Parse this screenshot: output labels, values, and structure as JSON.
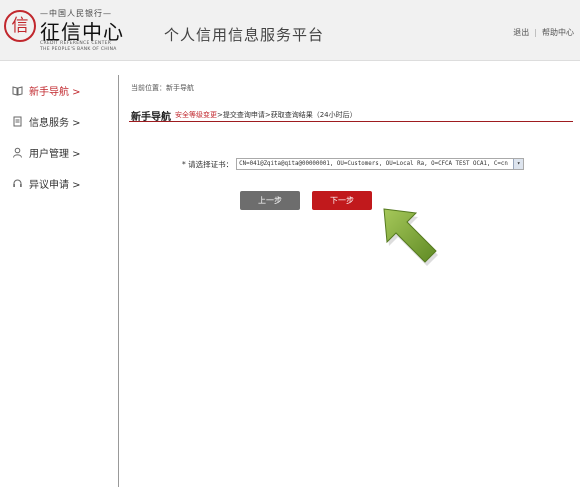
{
  "header": {
    "logo": {
      "emblem": "信",
      "bank_line": "—中国人民银行—",
      "name": "征信中心",
      "en_line1": "CREDIT REFERENCE CENTER",
      "en_line2": "THE PEOPLE'S BANK OF CHINA"
    },
    "platform_title": "个人信用信息服务平台",
    "links": {
      "logout": "退出",
      "help": "帮助中心",
      "separator": "|"
    }
  },
  "sidebar": {
    "items": [
      {
        "label": "新手导航 >",
        "icon": "book-icon",
        "active": true
      },
      {
        "label": "信息服务 >",
        "icon": "document-icon",
        "active": false
      },
      {
        "label": "用户管理 >",
        "icon": "user-icon",
        "active": false
      },
      {
        "label": "异议申请 >",
        "icon": "headset-icon",
        "active": false
      }
    ]
  },
  "main": {
    "breadcrumb": "当前位置：新手导航",
    "title": "新手导航",
    "steps": {
      "current": "安全等级变更",
      "rest": ">提交查询申请>获取查询结果（24小时后）"
    },
    "form": {
      "label": "* 请选择证书：",
      "selected_value": "CN=041@Zqita@qita@00000001, OU=Customers, OU=Local Ra, O=CFCA TEST OCA1, C=cn"
    },
    "buttons": {
      "prev": "上一步",
      "next": "下一步"
    }
  },
  "colors": {
    "accent": "#c1272d",
    "next_button": "#c1191c",
    "prev_button": "#6d6d6d",
    "pointer_arrow": "#7fa23a"
  }
}
